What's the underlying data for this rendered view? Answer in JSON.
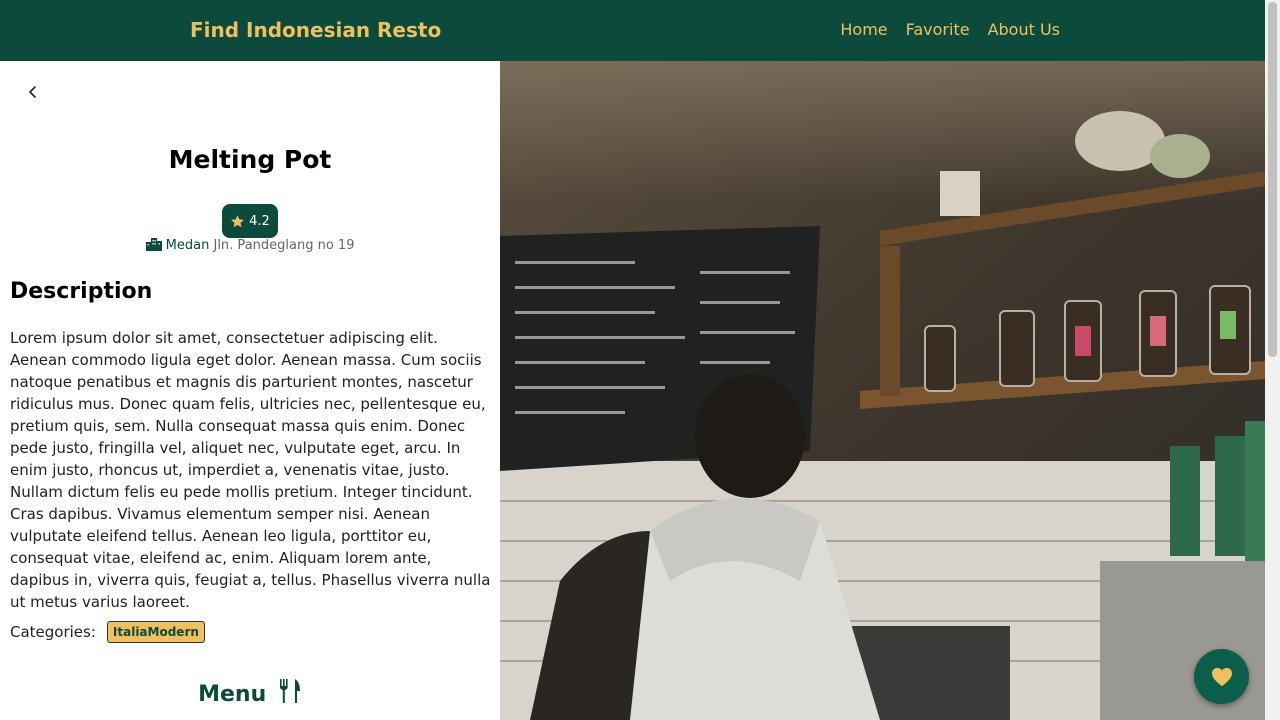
{
  "header": {
    "brand": "Find Indonesian Resto",
    "nav": [
      "Home",
      "Favorite",
      "About Us"
    ]
  },
  "detail": {
    "name": "Melting Pot",
    "rating": "4.2",
    "city": "Medan",
    "address": "Jln. Pandeglang no 19",
    "description_heading": "Description",
    "description": "Lorem ipsum dolor sit amet, consectetuer adipiscing elit. Aenean commodo ligula eget dolor. Aenean massa. Cum sociis natoque penatibus et magnis dis parturient montes, nascetur ridiculus mus. Donec quam felis, ultricies nec, pellentesque eu, pretium quis, sem. Nulla consequat massa quis enim. Donec pede justo, fringilla vel, aliquet nec, vulputate eget, arcu. In enim justo, rhoncus ut, imperdiet a, venenatis vitae, justo. Nullam dictum felis eu pede mollis pretium. Integer tincidunt. Cras dapibus. Vivamus elementum semper nisi. Aenean vulputate eleifend tellus. Aenean leo ligula, porttitor eu, consequat vitae, eleifend ac, enim. Aliquam lorem ante, dapibus in, viverra quis, feugiat a, tellus. Phasellus viverra nulla ut metus varius laoreet.",
    "categories_label": "Categories:",
    "categories": [
      "ItaliaModern"
    ],
    "menu_heading": "Menu"
  },
  "icons": {
    "back": "chevron-left-icon",
    "rating": "star-icon",
    "city": "city-icon",
    "menu": "utensils-icon",
    "favorite": "heart-icon"
  },
  "colors": {
    "primary": "#0c4a3c",
    "accent": "#f0c060"
  }
}
